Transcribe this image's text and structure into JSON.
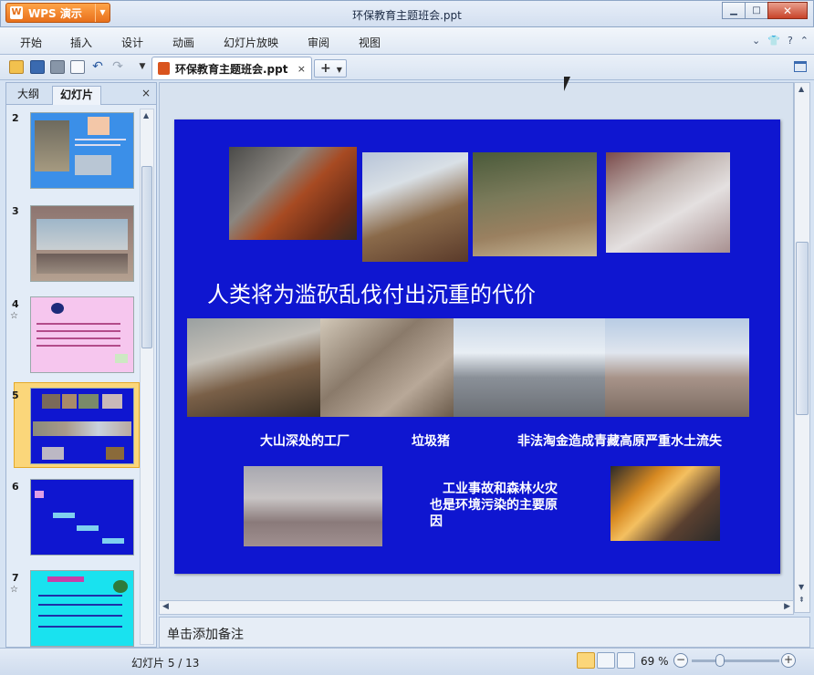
{
  "app": {
    "name": "WPS 演示",
    "logo": "W"
  },
  "window": {
    "title": "环保教育主题班会.ppt"
  },
  "menu": [
    "开始",
    "插入",
    "设计",
    "动画",
    "幻灯片放映",
    "审阅",
    "视图"
  ],
  "document_tab": {
    "label": "环保教育主题班会.ppt",
    "close": "×"
  },
  "new_tab": {
    "label": "+"
  },
  "left_panel": {
    "tabs": [
      "大纲",
      "幻灯片"
    ],
    "active_tab": "幻灯片",
    "close": "×",
    "thumbnails": [
      {
        "number": "2",
        "star": ""
      },
      {
        "number": "3",
        "star": ""
      },
      {
        "number": "4",
        "star": "☆"
      },
      {
        "number": "5",
        "star": "",
        "selected": true
      },
      {
        "number": "6",
        "star": ""
      },
      {
        "number": "7",
        "star": "☆"
      }
    ]
  },
  "slide": {
    "heading": "人类将为滥砍乱伐付出沉重的代价",
    "caption_factory": "大山深处的工厂",
    "caption_pig": "垃圾猪",
    "caption_mining": "非法淘金造成青藏高原严重水土流失",
    "caption_accident": "工业事故和森林火灾也是环境污染的主要原因"
  },
  "notes": {
    "placeholder": "单击添加备注"
  },
  "status": {
    "slide_indicator": "幻灯片 5 / 13",
    "zoom": "69 %"
  },
  "colors": {
    "slide_bg": "#0f16d0",
    "accent_orange": "#e8701c",
    "selection": "#fbd67a"
  }
}
